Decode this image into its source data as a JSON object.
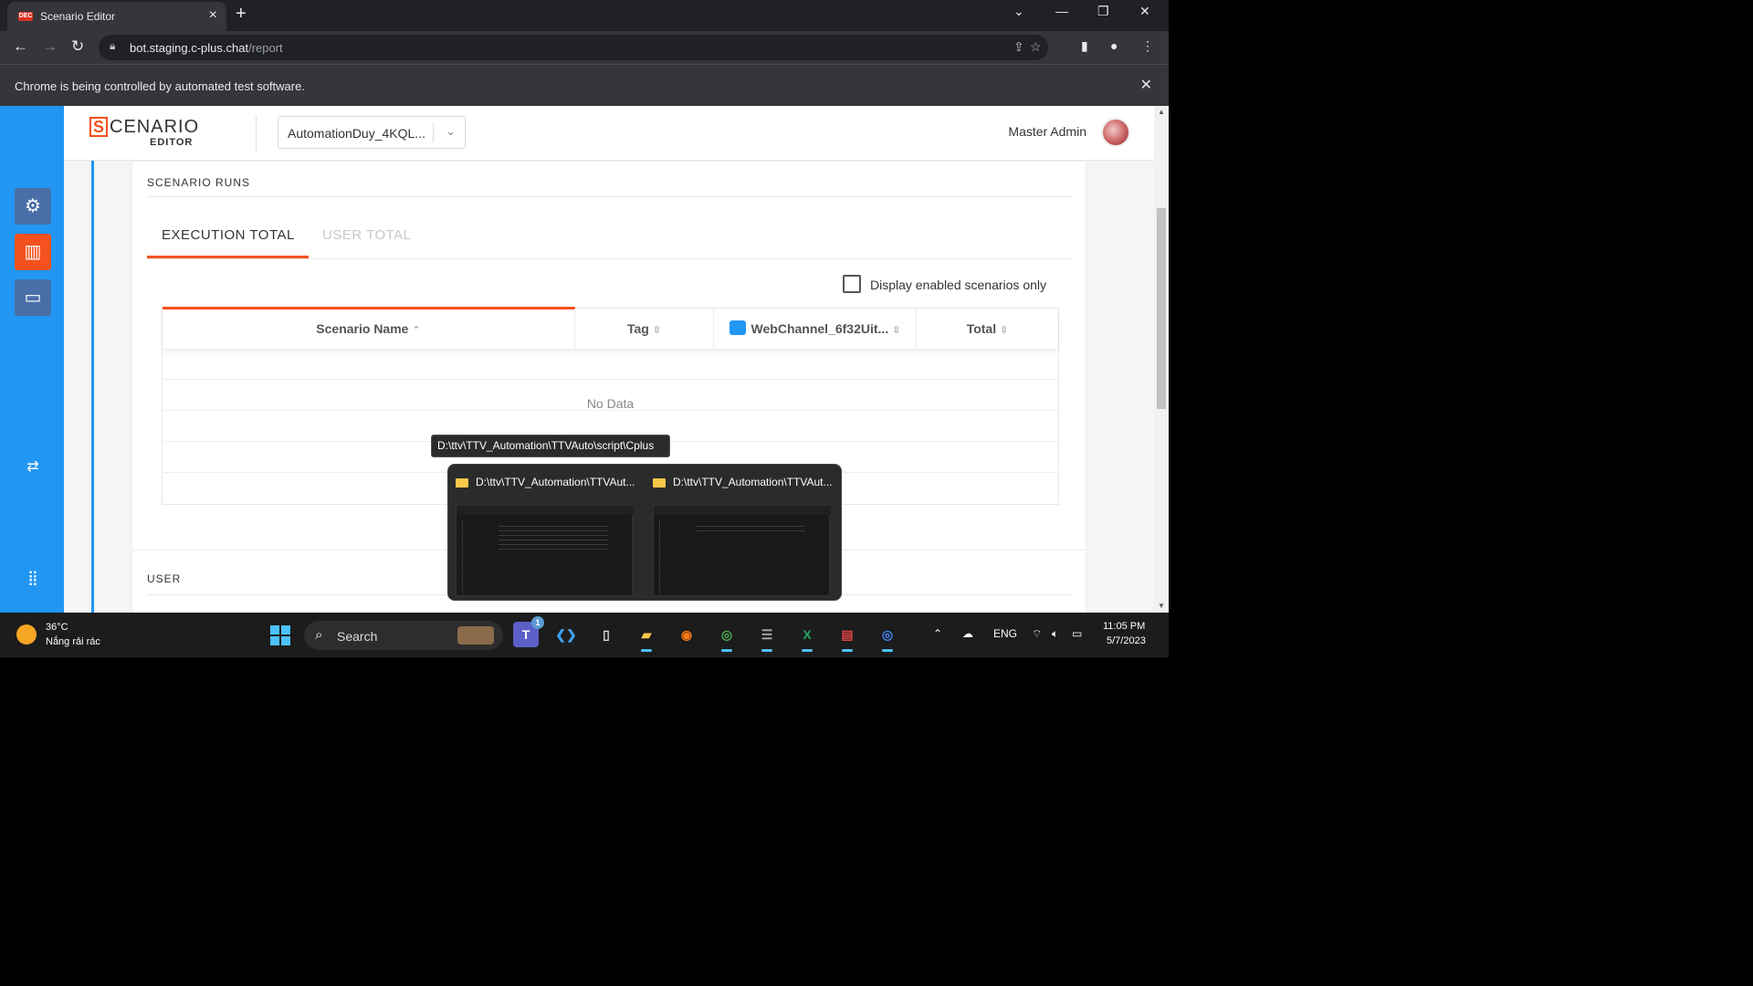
{
  "browser": {
    "tab_title": "Scenario Editor",
    "tab_favicon_text": "DEC",
    "url_host": "bot.staging.c-plus.chat",
    "url_path": "/report",
    "automation_notice": "Chrome is being controlled by automated test software."
  },
  "app": {
    "logo_text": "CENARIO",
    "logo_letter": "S",
    "logo_sub": "EDITOR",
    "bot_selector_value": "AutomationDuy_4KQL...",
    "user_name": "Master Admin",
    "accent_color": "#f4511e",
    "nav_color": "#2196f3"
  },
  "nav": {
    "items": [
      {
        "icon": "gear-icon",
        "name": "settings"
      },
      {
        "icon": "report-icon",
        "name": "report",
        "active": true
      },
      {
        "icon": "chat-icon",
        "name": "chat"
      },
      {
        "icon": "swap-icon",
        "name": "swap"
      },
      {
        "icon": "apps-grid-icon",
        "name": "apps"
      }
    ]
  },
  "scenario_runs": {
    "title": "SCENARIO RUNS",
    "tabs": [
      {
        "label": "EXECUTION TOTAL",
        "active": true
      },
      {
        "label": "USER TOTAL",
        "active": false
      }
    ],
    "checkbox_label": "Display enabled scenarios only",
    "checkbox_checked": false,
    "columns": [
      {
        "label": "Scenario Name",
        "sort": "asc"
      },
      {
        "label": "Tag",
        "sort": "none"
      },
      {
        "label": "WebChannel_6f32Uit...",
        "sort": "none"
      },
      {
        "label": "Total",
        "sort": "none"
      }
    ],
    "empty_text": "No Data"
  },
  "user_section": {
    "title": "USER"
  },
  "popup": {
    "tooltip": "D:\\ttv\\TTV_Automation\\TTVAuto\\script\\Cplus",
    "windows": [
      {
        "title": "D:\\ttv\\TTV_Automation\\TTVAut..."
      },
      {
        "title": "D:\\ttv\\TTV_Automation\\TTVAut..."
      }
    ]
  },
  "taskbar": {
    "temperature": "36°C",
    "weather": "Nắng rải rác",
    "search_label": "Search",
    "teams_badge": "1",
    "language": "ENG",
    "time": "11:05 PM",
    "date": "5/7/2023"
  }
}
